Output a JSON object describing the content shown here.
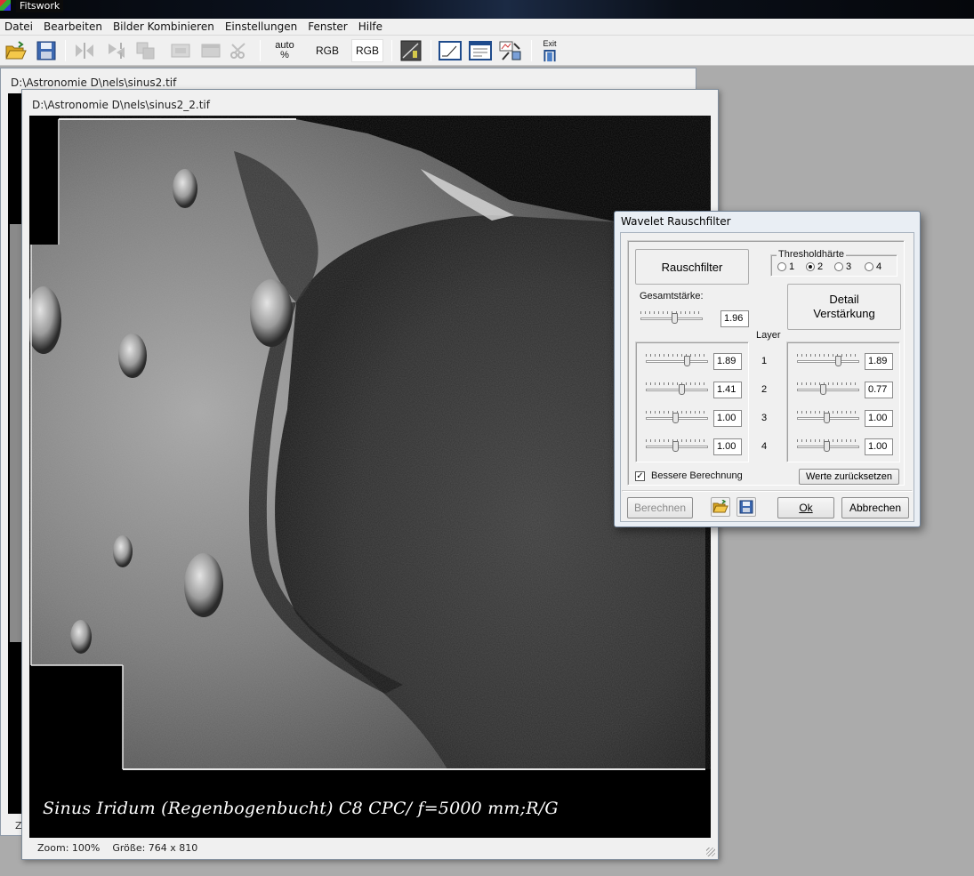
{
  "app": {
    "title": "Fitswork"
  },
  "menu": [
    "Datei",
    "Bearbeiten",
    "Bilder Kombinieren",
    "Einstellungen",
    "Fenster",
    "Hilfe"
  ],
  "toolbar": {
    "auto_label_1": "auto",
    "auto_label_2": "%",
    "rgb_1": "RGB",
    "rgb_2": "RGB",
    "exit_label": "Exit"
  },
  "back_window": {
    "title": "D:\\Astronomie D\\nels\\sinus2.tif",
    "status_prefix": "Z"
  },
  "front_window": {
    "title": "D:\\Astronomie D\\nels\\sinus2_2.tif",
    "caption": "Sinus Iridum (Regenbogenbucht) C8 CPC/ f=5000 mm;R/G",
    "status_zoom": "Zoom: 100%",
    "status_size": "Größe: 764 x 810"
  },
  "dialog": {
    "title": "Wavelet Rauschfilter",
    "rauschfilter_button": "Rauschfilter",
    "threshold_label": "Thresholdhärte",
    "threshold_options": [
      "1",
      "2",
      "3",
      "4"
    ],
    "threshold_selected": 2,
    "gesamt_label": "Gesamtstärke:",
    "gesamt_value": "1.96",
    "gesamt_level": 0.55,
    "detail_button_line1": "Detail",
    "detail_button_line2": "Verstärkung",
    "layer_label": "Layer",
    "layers": [
      {
        "num": "1",
        "left_value": "1.89",
        "left_level": 0.68,
        "right_value": "1.89",
        "right_level": 0.68
      },
      {
        "num": "2",
        "left_value": "1.41",
        "left_level": 0.58,
        "right_value": "0.77",
        "right_level": 0.42
      },
      {
        "num": "3",
        "left_value": "1.00",
        "left_level": 0.48,
        "right_value": "1.00",
        "right_level": 0.48
      },
      {
        "num": "4",
        "left_value": "1.00",
        "left_level": 0.48,
        "right_value": "1.00",
        "right_level": 0.48
      }
    ],
    "bessere_label": "Bessere Berechnung",
    "bessere_checked": true,
    "reset_button": "Werte zurücksetzen",
    "berechnen_button": "Berechnen",
    "ok_button": "Ok",
    "abbrechen_button": "Abbrechen"
  }
}
